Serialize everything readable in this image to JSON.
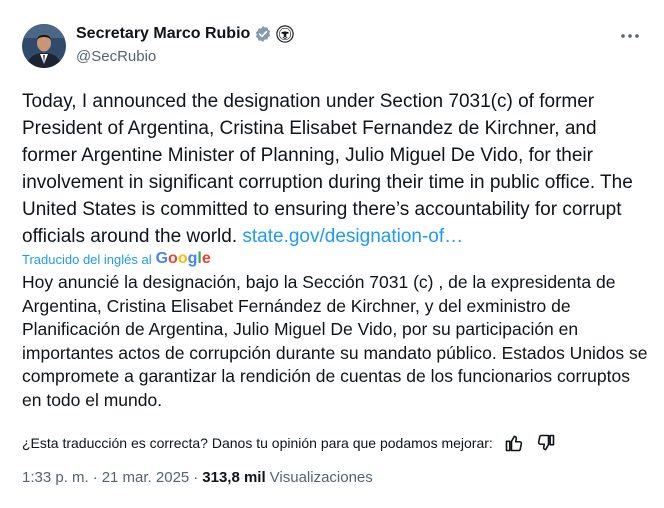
{
  "author": {
    "display_name": "Secretary Marco Rubio",
    "handle": "@SecRubio",
    "verified_color": "#829aab"
  },
  "more_menu_icon": "more-horizontal-icon",
  "tweet": {
    "text_before_link": "Today, I announced the designation under Section 7031(c) of former President of Argentina, Cristina Elisabet Fernandez de Kirchner, and former Argentine Minister of Planning, Julio Miguel De Vido, for their involvement in significant corruption during their time in public office. The United States is committed to ensuring there’s accountability for corrupt officials around the world. ",
    "link_text": "state.gov/designation-of…"
  },
  "translation": {
    "translated_by_label": "Traducido del inglés al",
    "provider": "Google",
    "text": "Hoy anuncié la designación, bajo la Sección 7031 (c) , de la expresidenta de Argentina, Cristina Elisabet Fernández de Kirchner, y del exministro de Planificación de Argentina, Julio Miguel De Vido, por su participación en importantes actos de corrupción durante su mandato público. Estados Unidos se compromete a garantizar la rendición de cuentas de los funcionarios corruptos en todo el mundo."
  },
  "feedback": {
    "question": "¿Esta traducción es correcta? Danos tu opinión para que podamos mejorar:"
  },
  "meta": {
    "time": "1:33 p. m.",
    "separator1": "·",
    "date": "21 mar. 2025",
    "separator2": "·",
    "views_count": "313,8 mil",
    "views_label": "Visualizaciones"
  },
  "colors": {
    "link": "#1d9bf0",
    "secondary_text": "#536471",
    "primary_text": "#0f1419"
  }
}
